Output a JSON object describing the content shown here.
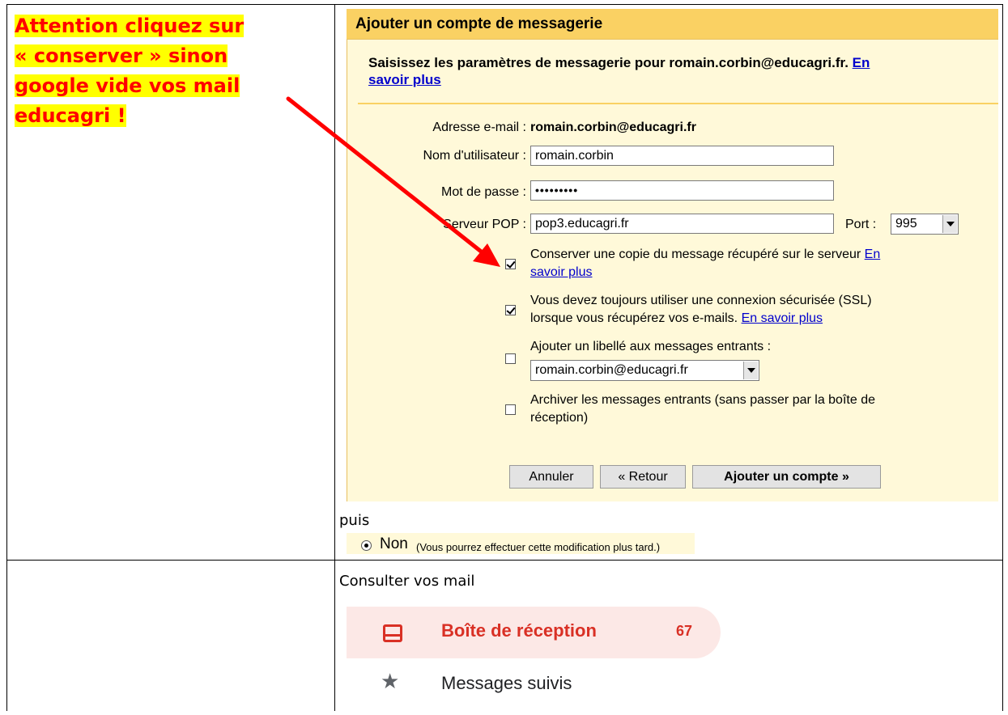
{
  "warning": {
    "line1": "Attention cliquez sur",
    "line2": "« conserver » sinon",
    "line3": "google vide vos mail",
    "line4": "educagri !"
  },
  "dialog": {
    "title": "Ajouter un compte de messagerie",
    "intro": "Saisissez les paramètres de messagerie pour romain.corbin@educagri.fr.",
    "intro_link_1": "En",
    "intro_link_2": "savoir plus",
    "email_label": "Adresse e-mail :",
    "email_value": "romain.corbin@educagri.fr",
    "username_label": "Nom d'utilisateur :",
    "username_value": "romain.corbin",
    "password_label": "Mot de passe :",
    "password_value": "•••••••••",
    "pop_label": "Serveur POP :",
    "pop_value": "pop3.educagri.fr",
    "port_label": "Port :",
    "port_value": "995",
    "options": [
      {
        "checked": true,
        "line1": "Conserver une copie du message récupéré sur le serveur",
        "link1": "En",
        "line2_link": "savoir plus",
        "line2": ""
      },
      {
        "checked": true,
        "line1": "Vous devez toujours utiliser une connexion sécurisée (SSL)",
        "line2": "lorsque vous récupérez vos e-mails.",
        "line2_link": "En savoir plus"
      },
      {
        "checked": false,
        "line1": "Ajouter un libellé aux messages entrants :",
        "select_value": "romain.corbin@educagri.fr"
      },
      {
        "checked": false,
        "line1": "Archiver les messages entrants (sans passer par la boîte de",
        "line2": "réception)"
      }
    ],
    "cancel_button": "Annuler",
    "back_button": "« Retour",
    "add_button": "Ajouter un compte »"
  },
  "puis": "puis",
  "non_option": {
    "label": "Non",
    "note": "(Vous pourrez effectuer cette modification plus tard.)"
  },
  "consult": "Consulter vos mail",
  "mail_nav": {
    "inbox_label": "Boîte de réception",
    "inbox_count": "67",
    "starred_label": "Messages suivis"
  },
  "colors": {
    "warning_text": "#ff0000",
    "warning_highlight": "#ffff00",
    "dialog_header": "#fad163",
    "dialog_bg": "#fff9d9",
    "link": "#0000cc",
    "gmail_red": "#d93025",
    "inbox_bg": "#fce8e6"
  }
}
